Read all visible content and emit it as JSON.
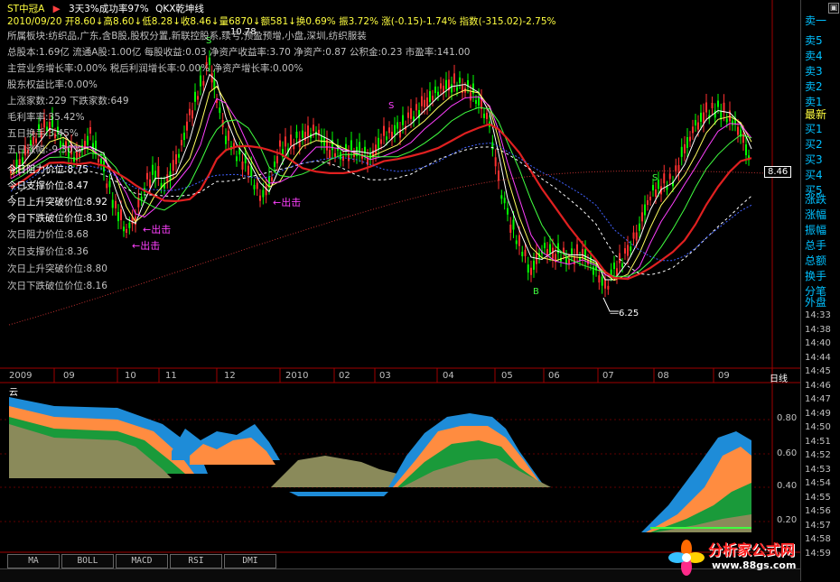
{
  "header": {
    "stock_name": "ST中冠A",
    "arrow": "▶",
    "indicator_desc": "3天3%成功率97%",
    "indicator_name": "QKX乾坤线",
    "quote_line": "2010/09/20 开8.60↓高8.60↓低8.28↓收8.46↓量6870↓额581↓换0.69% 振3.72% 涨(-0.15)-1.74% 指数(-315.02)-2.75%"
  },
  "info_lines": [
    "所属板块:纺织品,广东,含B股,股权分置,新联控股系,续亏,预盈预增,小盘,深圳,纺织服装",
    "总股本:1.69亿 流通A股:1.00亿 每股收益:0.03 净资产收益率:3.70 净资产:0.87 公积金:0.23 市盈率:141.00",
    "主营业务增长率:0.00% 税后利润增长率:0.00% 净资产增长率:0.00%",
    "股东权益比率:0.00%",
    "上涨家数:229  下跌家数:649",
    "毛利率率:35.42%",
    "五日换手:3.45%",
    "五日涨幅:-9.30%"
  ],
  "levels_today": [
    "今日阻力价位:8.75",
    "今日支撑价位:8.47",
    "今日上升突破价位:8.92",
    "今日下跌破位价位:8.30"
  ],
  "levels_next": [
    "次日阻力价位:8.68",
    "次日支撑价位:8.36",
    "次日上升突破价位:8.80",
    "次日下跌破位价位:8.16"
  ],
  "annotations": {
    "exit_label": "出击",
    "high_label": "10.78",
    "low_label": "6.25",
    "s_marker": "S",
    "b_marker": "B",
    "price_tag": "8.46"
  },
  "x_axis": [
    "2009",
    "09",
    "10",
    "11",
    "12",
    "2010",
    "02",
    "03",
    "04",
    "05",
    "06",
    "07",
    "08",
    "09"
  ],
  "period_label": "日线",
  "sub_chart": {
    "title": "云",
    "y_labels": [
      "0.80",
      "0.60",
      "0.40",
      "0.20"
    ]
  },
  "right_panel": {
    "top_cut": "卖一",
    "sell_labels": [
      "卖5",
      "卖4",
      "卖3",
      "卖2",
      "卖1"
    ],
    "latest": "最新",
    "buy_labels": [
      "买1",
      "买2",
      "买3",
      "买4",
      "买5"
    ],
    "stats": [
      "涨跌",
      "涨幅",
      "振幅",
      "总手",
      "总额",
      "换手",
      "分笔"
    ],
    "outer": "外盘",
    "times": [
      "14:33",
      "14:38",
      "14:40",
      "14:44",
      "14:45",
      "14:46",
      "14:47",
      "14:49",
      "14:50",
      "14:51",
      "14:52",
      "14:53",
      "14:54",
      "14:55",
      "14:56",
      "14:57",
      "14:58",
      "14:59"
    ]
  },
  "tabs": [
    "MA",
    "BOLL",
    "MACD",
    "RSI",
    "DMI"
  ],
  "logo": {
    "text": "分析家公式网",
    "url": "www.88gs.com"
  },
  "colors": {
    "up": "#ff3030",
    "down": "#00ff00",
    "ma_red": "#e02020",
    "ma_white": "#ffffff",
    "ma_magenta": "#ff00ff",
    "ma_green": "#40ff40",
    "cloud_blue": "#1e8cd8",
    "cloud_orange": "#ff8c40",
    "cloud_green": "#1a9a3a",
    "cloud_olive": "#8a8a5a"
  }
}
